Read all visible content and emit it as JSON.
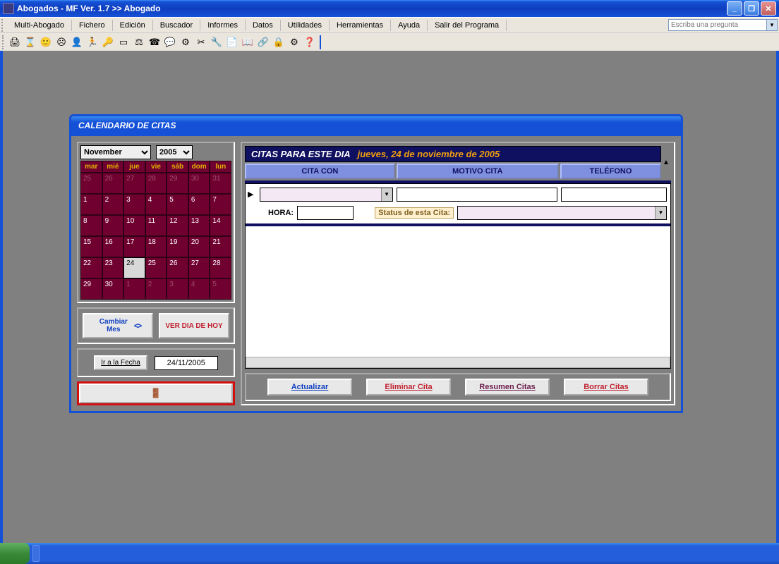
{
  "titlebar": {
    "text": "Abogados - MF  Ver. 1.7 >> Abogado"
  },
  "menu": {
    "items": [
      "Multi-Abogado",
      "Fichero",
      "Edición",
      "Buscador",
      "Informes",
      "Datos",
      "Utilidades",
      "Herramientas",
      "Ayuda",
      "Salir del Programa"
    ],
    "search_placeholder": "Escriba una pregunta"
  },
  "toolbar_icons": [
    "🖨",
    "⌛",
    "🙂",
    "☹",
    "👤",
    "🏃",
    "🔑",
    "▭",
    "⚖",
    "☎",
    "💬",
    "⚙",
    "✂",
    "🔧",
    "📄",
    "📖",
    "🔗",
    "🔒",
    "⚙",
    "❓"
  ],
  "inner_window": {
    "title": "CALENDARIO DE CITAS"
  },
  "calendar": {
    "month": "November",
    "year": "2005",
    "dayheaders": [
      "mar",
      "mié",
      "jue",
      "vie",
      "sáb",
      "dom",
      "lun"
    ],
    "cells": [
      {
        "n": "25",
        "c": "prev"
      },
      {
        "n": "26",
        "c": "prev"
      },
      {
        "n": "27",
        "c": "prev"
      },
      {
        "n": "28",
        "c": "prev"
      },
      {
        "n": "29",
        "c": "prev"
      },
      {
        "n": "30",
        "c": "prev"
      },
      {
        "n": "31",
        "c": "prev"
      },
      {
        "n": "1",
        "c": ""
      },
      {
        "n": "2",
        "c": ""
      },
      {
        "n": "3",
        "c": ""
      },
      {
        "n": "4",
        "c": ""
      },
      {
        "n": "5",
        "c": ""
      },
      {
        "n": "6",
        "c": ""
      },
      {
        "n": "7",
        "c": ""
      },
      {
        "n": "8",
        "c": ""
      },
      {
        "n": "9",
        "c": ""
      },
      {
        "n": "10",
        "c": ""
      },
      {
        "n": "11",
        "c": ""
      },
      {
        "n": "12",
        "c": ""
      },
      {
        "n": "13",
        "c": ""
      },
      {
        "n": "14",
        "c": ""
      },
      {
        "n": "15",
        "c": ""
      },
      {
        "n": "16",
        "c": ""
      },
      {
        "n": "17",
        "c": ""
      },
      {
        "n": "18",
        "c": ""
      },
      {
        "n": "19",
        "c": ""
      },
      {
        "n": "20",
        "c": ""
      },
      {
        "n": "21",
        "c": ""
      },
      {
        "n": "22",
        "c": ""
      },
      {
        "n": "23",
        "c": ""
      },
      {
        "n": "24",
        "c": "today"
      },
      {
        "n": "25",
        "c": ""
      },
      {
        "n": "26",
        "c": ""
      },
      {
        "n": "27",
        "c": ""
      },
      {
        "n": "28",
        "c": ""
      },
      {
        "n": "29",
        "c": ""
      },
      {
        "n": "30",
        "c": ""
      },
      {
        "n": "1",
        "c": "next"
      },
      {
        "n": "2",
        "c": "next"
      },
      {
        "n": "3",
        "c": "next"
      },
      {
        "n": "4",
        "c": "next"
      },
      {
        "n": "5",
        "c": "next"
      }
    ]
  },
  "nav": {
    "change_month": "Cambiar Mes",
    "arrows": "< >",
    "ver_hoy": "VER DIA DE HOY",
    "ir_fecha": "Ir a la Fecha",
    "date_value": "24/11/2005",
    "exit_icon": "🚪"
  },
  "citas": {
    "header": "CITAS PARA ESTE DIA",
    "date_text": "jueves, 24 de noviembre de 2005",
    "cols": {
      "cita_con": "CITA CON",
      "motivo": "MOTIVO CITA",
      "telefono": "TELÉFONO"
    },
    "hora_label": "HORA:",
    "status_label": "Status de esta Cita:"
  },
  "actions": {
    "actualizar": "Actualizar",
    "eliminar": "Eliminar Cita",
    "resumen": "Resumen Citas",
    "borrar": "Borrar Citas"
  }
}
